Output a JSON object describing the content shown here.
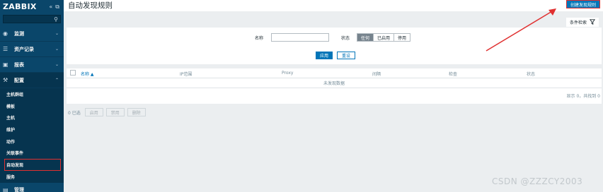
{
  "sidebar": {
    "logo": "ZABBIX",
    "collapse_glyph": "«",
    "expand_glyph": "⧉",
    "menu": [
      {
        "icon": "eye-icon",
        "label": "监测"
      },
      {
        "icon": "list-icon",
        "label": "资产记录"
      },
      {
        "icon": "chart-icon",
        "label": "报表"
      },
      {
        "icon": "wrench-icon",
        "label": "配置"
      }
    ],
    "submenu": [
      "主机群组",
      "模板",
      "主机",
      "维护",
      "动作",
      "关联事件",
      "自动发现",
      "服务"
    ],
    "bottom_menu_label": "管理"
  },
  "header": {
    "title": "自动发现规则",
    "create_button": "创建发现规则"
  },
  "filter": {
    "tab_label": "条件检索",
    "name_label": "名称",
    "name_value": "",
    "status_label": "状态",
    "status_options": [
      "任何",
      "已启用",
      "停用"
    ],
    "status_selected": "任何",
    "apply": "应用",
    "reset": "重设"
  },
  "table": {
    "columns": [
      "名称 ▲",
      "IP范围",
      "Proxy",
      "间隔",
      "检查",
      "状态"
    ],
    "empty_message": "未发现数据",
    "paging": "显示 0，共找到 0"
  },
  "mass_actions": {
    "selected": "0 已选",
    "buttons": [
      "启用",
      "禁用",
      "删除"
    ]
  },
  "watermark": "CSDN @ZZZCY2003",
  "colors": {
    "sidebar": "#0a466a",
    "accent": "#0275b8",
    "highlight": "#e03030"
  }
}
